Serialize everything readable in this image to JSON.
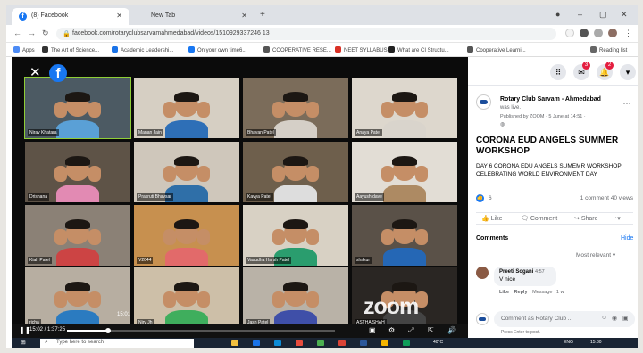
{
  "browser": {
    "tabs": [
      {
        "title": "(8) Facebook",
        "active": true
      },
      {
        "title": "New Tab",
        "active": false
      }
    ],
    "new_tab": "+",
    "url": "facebook.com/rotaryclubsarvamahmedabad/videos/1510929337246 13",
    "bookmarks": [
      {
        "label": "Apps",
        "color": "#4c8bf5"
      },
      {
        "label": "The Art of Science...",
        "color": "#333333"
      },
      {
        "label": "Academic Leadershi...",
        "color": "#1a73e8"
      },
      {
        "label": "On your own time6...",
        "color": "#1877f2"
      },
      {
        "label": "COOPERATIVE RESE...",
        "color": "#555555"
      },
      {
        "label": "NEET SYLLABUS",
        "color": "#d93025"
      },
      {
        "label": "What are CI Structu...",
        "color": "#222222"
      },
      {
        "label": "Cooperative Learni...",
        "color": "#555555"
      },
      {
        "label": "Reading list",
        "color": "#666666"
      }
    ]
  },
  "video": {
    "participants": [
      "Nirav Khatara",
      "Manan Jain",
      "Bhavan Patel",
      "Anaya Patel",
      "Drishana",
      "Prakruti Bhavsar",
      "Kavya Patel",
      "Aayush dave",
      "Kiah Patel",
      "V2044",
      "Vasudha Harsh Patel",
      "shakur",
      "richa",
      "Nirv Jh",
      "Jash Patel",
      "ASTHA SHAH"
    ],
    "zoom_watermark": "zoom",
    "overlay_time": "15:01",
    "time_display": "15:02 / 1:37:25",
    "progress_fraction": 0.153,
    "accent": "#8fce37"
  },
  "taskbar": {
    "search_placeholder": "Type here to search",
    "weather": "40°C",
    "lang": "ENG",
    "clock": "15:30"
  },
  "post": {
    "page_name": "Rotary Club Sarvam - Ahmedabad",
    "was_live": "was live.",
    "published": "Published by ZOOM · 5 June at 14:51 ·",
    "title": "CORONA EUD ANGELS SUMMER WORKSHOP",
    "description": "DAY 6 CORONA EDU ANGELS SUMEMR WORKSHOP CELEBRATING WORLD ENVIRONMENT DAY",
    "reactions": "6",
    "stats": "1 comment  40 views",
    "actions": {
      "like": "Like",
      "comment": "Comment",
      "share": "Share"
    },
    "comments_heading": "Comments",
    "hide": "Hide",
    "sort": "Most relevant",
    "comment": {
      "author": "Preeti Sogani",
      "time": "4:57",
      "text": "V nice",
      "like": "Like",
      "reply": "Reply",
      "message": "Message",
      "age": "1 w"
    },
    "input_placeholder": "Comment as Rotary Club ...",
    "enter_hint": "Press Enter to post."
  },
  "header": {
    "notif_badge_1": "3",
    "notif_badge_2": "2"
  },
  "colors": {
    "facebook_blue": "#1877f2",
    "notification_red": "#e41e3f"
  }
}
